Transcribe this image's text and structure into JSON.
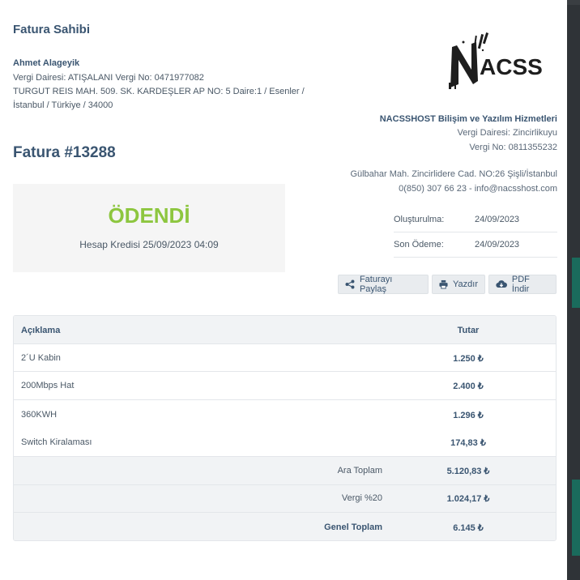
{
  "owner": {
    "title": "Fatura Sahibi",
    "name": "Ahmet Alageyik",
    "tax_line": "Vergi Dairesi: ATIŞALANI Vergi No: 0471977082",
    "address_line1": "TURGUT REIS MAH. 509. SK. KARDEŞLER AP NO: 5 Daire:1 / Esenler /",
    "address_line2": "İstanbul / Türkiye / 34000"
  },
  "logo": {
    "text": "ACSS",
    "initial": "N",
    "icon": "nacss-logo"
  },
  "company": {
    "name": "NACSSHOST Bilişim ve Yazılım Hizmetleri",
    "tax_office": "Vergi Dairesi: Zincirlikuyu",
    "tax_no": "Vergi No: 0811355232",
    "address": "Gülbahar Mah. Zincirlidere Cad. NO:26 Şişli/İstanbul",
    "contact": "0(850) 307 66 23 - info@nacsshost.com"
  },
  "invoice": {
    "title": "Fatura #13288",
    "status": "ÖDENDİ",
    "payment_info": "Hesap Kredisi 25/09/2023 04:09"
  },
  "dates": [
    {
      "label": "Oluşturulma:",
      "value": "24/09/2023"
    },
    {
      "label": "Son Ödeme:",
      "value": "24/09/2023"
    }
  ],
  "actions": {
    "share": "Faturayı Paylaş",
    "print": "Yazdır",
    "pdf": "PDF İndir"
  },
  "table": {
    "headers": {
      "description": "Açıklama",
      "amount": "Tutar"
    },
    "items": [
      {
        "description": "2´U Kabin",
        "amount": "1.250 ₺"
      },
      {
        "description": "200Mbps Hat",
        "amount": "2.400 ₺"
      },
      {
        "description": "360KWH",
        "amount": "1.296 ₺"
      },
      {
        "description": "Switch Kiralaması",
        "amount": "174,83 ₺"
      }
    ],
    "subtotal": {
      "label": "Ara Toplam",
      "amount": "5.120,83 ₺"
    },
    "tax": {
      "label": "Vergi %20",
      "amount": "1.024,17 ₺"
    },
    "total": {
      "label": "Genel Toplam",
      "amount": "6.145 ₺"
    }
  },
  "colors": {
    "accent": "#3a5571",
    "paid": "#8dc63f",
    "backdrop_teal": "#1a6b5c"
  }
}
